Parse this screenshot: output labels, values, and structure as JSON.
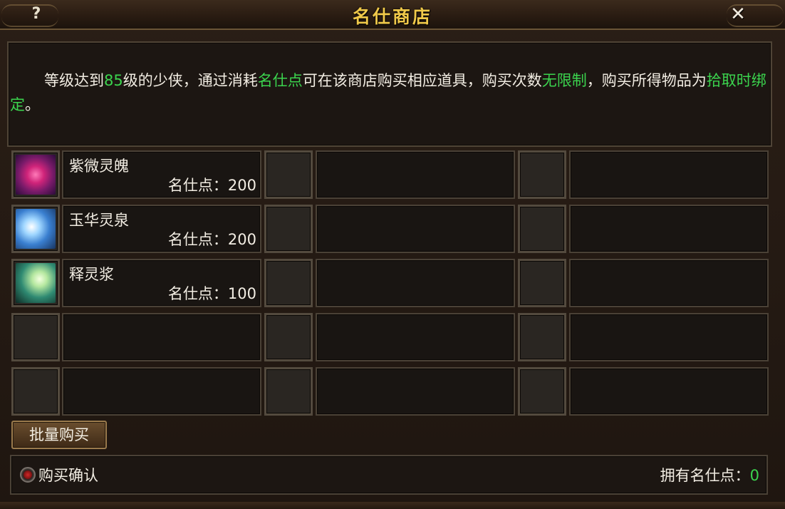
{
  "window": {
    "title": "名仕商店",
    "help_icon": "?",
    "close_icon": "✕"
  },
  "description": {
    "part1": "等级达到",
    "level": "85",
    "part2": "级的少侠，通过消耗",
    "currency": "名仕点",
    "part3": "可在该商店购买相应道具，购买次数",
    "limit": "无限制",
    "part4": "，购买所得物品为",
    "bind": "拾取时绑定",
    "part5": "。"
  },
  "items": [
    {
      "name": "紫微灵魄",
      "price": "名仕点：200",
      "icon": "heart-gem-icon"
    },
    {
      "name": "玉华灵泉",
      "price": "名仕点：200",
      "icon": "spring-icon"
    },
    {
      "name": "释灵浆",
      "price": "名仕点：100",
      "icon": "potion-icon"
    }
  ],
  "buttons": {
    "bulk_buy": "批量购买"
  },
  "footer": {
    "confirm_label": "购买确认",
    "points_label": "拥有名仕点：",
    "points_value": "0"
  },
  "colors": {
    "highlight": "#3bd44e",
    "title": "#f0c94a",
    "text": "#f2ede3"
  }
}
